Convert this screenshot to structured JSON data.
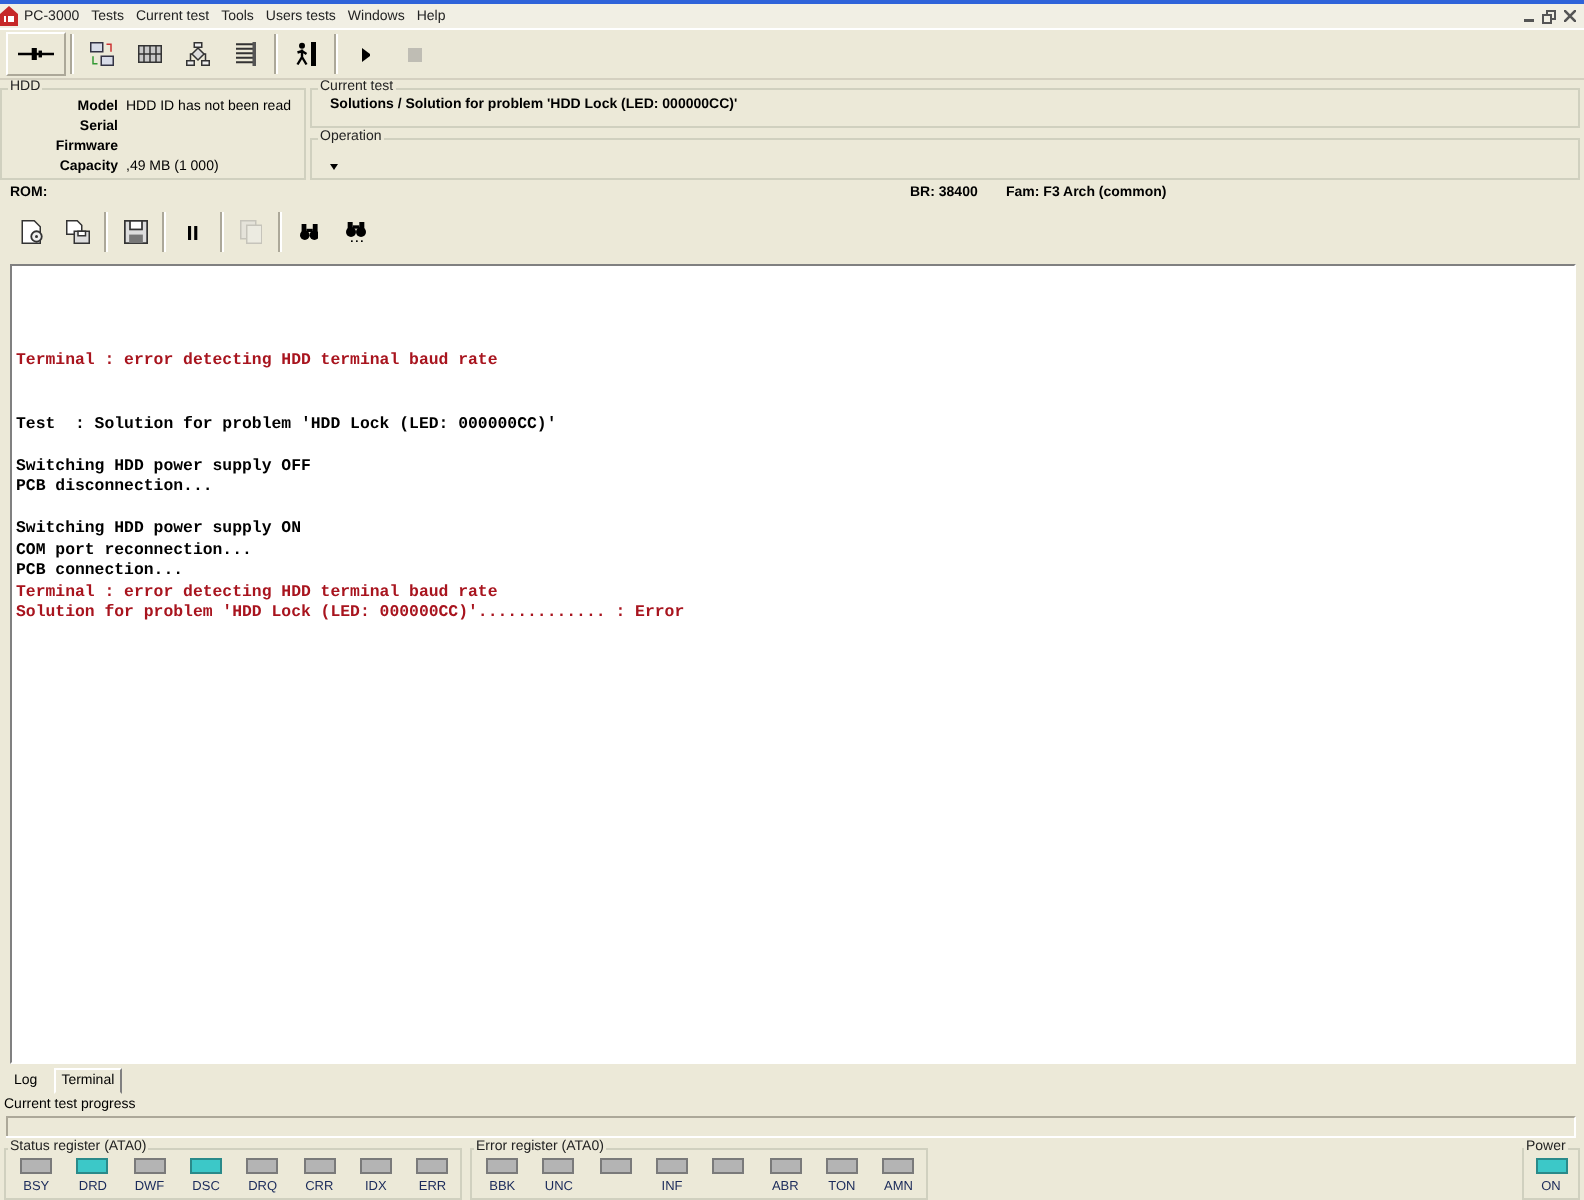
{
  "menu": [
    "PC-3000",
    "Tests",
    "Current test",
    "Tools",
    "Users tests",
    "Windows",
    "Help"
  ],
  "toolbar_top": {
    "groups": [
      [
        {
          "pressed": true,
          "disabled": false
        }
      ],
      [
        {
          "pressed": false,
          "disabled": false
        },
        {
          "pressed": false,
          "disabled": false
        },
        {
          "pressed": false,
          "disabled": false
        },
        {
          "pressed": false,
          "disabled": false
        }
      ],
      [
        {
          "pressed": false,
          "disabled": false
        }
      ],
      [
        {
          "pressed": false,
          "disabled": false
        },
        {
          "pressed": false,
          "disabled": true
        }
      ]
    ]
  },
  "hdd_panel": {
    "title": "HDD",
    "fields": [
      {
        "label": "Model",
        "value": "HDD ID has not been read"
      },
      {
        "label": "Serial"
      },
      {
        "label": "Firmware"
      },
      {
        "label": "Capacity",
        "value": ",49 MB (1 000)"
      }
    ]
  },
  "current_test": {
    "title": "Current test",
    "value": "Solutions / Solution for problem 'HDD Lock (LED: 000000CC)'"
  },
  "operation": {
    "title": "Operation"
  },
  "info_bar": {
    "rom": "ROM:",
    "baud_rate": "BR: 38400",
    "family": "Fam: F3 Arch (common)"
  },
  "toolbar_bottom": {
    "groups": [
      [
        {
          "disabled": false
        },
        {
          "disabled": false
        }
      ],
      [
        {
          "disabled": false
        }
      ],
      [
        {
          "disabled": false
        }
      ],
      [
        {
          "disabled": true
        }
      ],
      [
        {
          "disabled": false
        },
        {
          "disabled": false
        }
      ]
    ]
  },
  "terminal": {
    "blocks": [
      [
        {
          "kind": "error",
          "text": "Terminal : error detecting HDD terminal baud rate"
        }
      ],
      [
        {
          "kind": "normal",
          "text": "Test  : Solution for problem 'HDD Lock (LED: 000000CC)'"
        }
      ],
      [
        {
          "kind": "normal",
          "text": "Switching HDD power supply OFF"
        },
        {
          "kind": "normal",
          "text": "PCB disconnection..."
        }
      ],
      [
        {
          "kind": "normal",
          "text": "Switching HDD power supply ON"
        },
        {
          "kind": "normal",
          "text": "COM port reconnection..."
        },
        {
          "kind": "normal",
          "text": "PCB connection..."
        },
        {
          "kind": "error",
          "text": "Terminal : error detecting HDD terminal baud rate"
        },
        {
          "kind": "error",
          "text": "Solution for problem 'HDD Lock (LED: 000000CC)'............. : Error"
        }
      ]
    ]
  },
  "tabs": [
    {
      "label": "Log",
      "selected": false
    },
    {
      "label": "Terminal",
      "selected": true
    }
  ],
  "progress": {
    "label": "Current test progress",
    "level": 0
  },
  "status_register": {
    "title": "Status register (ATA0)",
    "leds": [
      {
        "label": "BSY",
        "on": false
      },
      {
        "label": "DRD",
        "on": true
      },
      {
        "label": "DWF",
        "on": false
      },
      {
        "label": "DSC",
        "on": true
      },
      {
        "label": "DRQ",
        "on": false
      },
      {
        "label": "CRR",
        "on": false
      },
      {
        "label": "IDX",
        "on": false
      },
      {
        "label": "ERR",
        "on": false
      }
    ]
  },
  "error_register": {
    "title": "Error register (ATA0)",
    "leds": [
      {
        "label": "BBK",
        "on": false
      },
      {
        "label": "UNC",
        "on": false
      },
      {
        "on": false
      },
      {
        "label": "INF",
        "on": false
      },
      {
        "on": false
      },
      {
        "label": "ABR",
        "on": false
      },
      {
        "label": "TON",
        "on": false
      },
      {
        "label": "AMN",
        "on": false
      }
    ]
  },
  "power": {
    "title": "Power",
    "label": "ON",
    "on": true
  }
}
